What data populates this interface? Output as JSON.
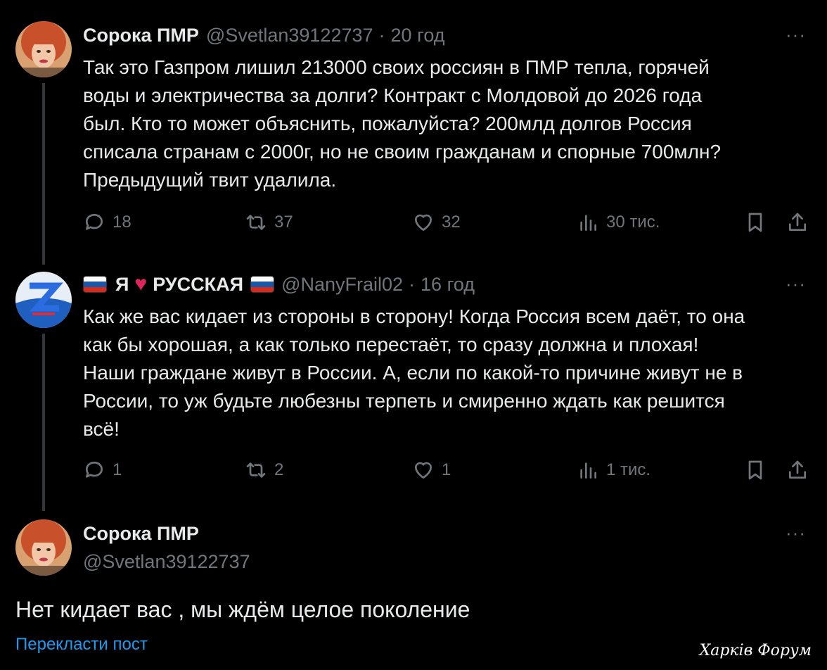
{
  "tweet1": {
    "name": "Сорока ПМР",
    "handle": "@Svetlan39122737",
    "dot": "·",
    "time": "20 год",
    "more": "···",
    "lines": [
      "Так это Газпром лишил 213000 своих россиян  в ПМР тепла, горячей",
      "воды и электричества за долги? Контракт с Молдовой до 2026 года",
      "был. Кто то может объяснить, пожалуйста? 200млд долгов Россия",
      "списала странам с 2000г, но не своим гражданам и спорные 700млн?",
      "Предыдущий твит удалила."
    ],
    "replies": "18",
    "reposts": "37",
    "likes": "32",
    "views": "30 тис."
  },
  "tweet2": {
    "name_left": "Я",
    "name_right": "РУССКАЯ",
    "handle": "@NanyFrail02",
    "dot": "·",
    "time": "16 год",
    "more": "···",
    "lines": [
      "Как же вас кидает из стороны в сторону! Когда Россия всем даёт, то она",
      "как бы хорошая, а как только перестаёт, то сразу должна и плохая!",
      "Наши граждане живут в России. А, если по какой-то причине живут не в",
      "России, то уж будьте любезны терпеть и смиренно ждать как решится",
      "всё!"
    ],
    "replies": "1",
    "reposts": "2",
    "likes": "1",
    "views": "1 тис."
  },
  "tweet3": {
    "name": "Сорока ПМР",
    "handle": "@Svetlan39122737",
    "more": "···",
    "text": "Нет кидает вас , мы ждём целое поколение",
    "translate": "Перекласти пост"
  },
  "watermark": "Харків Форум",
  "colors": {
    "background": "#000000",
    "text": "#e7e9ea",
    "muted": "#71767b",
    "link": "#1d9bf0",
    "thread_line": "#333639"
  },
  "icons": [
    "reply-icon",
    "repost-icon",
    "like-icon",
    "views-icon",
    "bookmark-icon",
    "share-icon",
    "more-icon"
  ]
}
